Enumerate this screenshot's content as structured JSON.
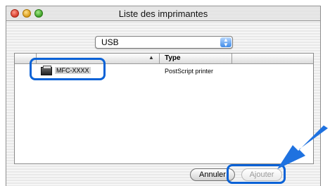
{
  "window": {
    "title": "Liste des imprimantes"
  },
  "connection_select": {
    "value": "USB"
  },
  "printer_list": {
    "columns": [
      "",
      "Type"
    ],
    "rows": [
      {
        "name": "MFC-XXXX",
        "type": "PostScript printer"
      }
    ]
  },
  "buttons": {
    "cancel_label": "Annuler",
    "add_label": "Ajouter"
  },
  "colors": {
    "highlight": "#0a62d6",
    "arrow": "#1f72e0"
  }
}
